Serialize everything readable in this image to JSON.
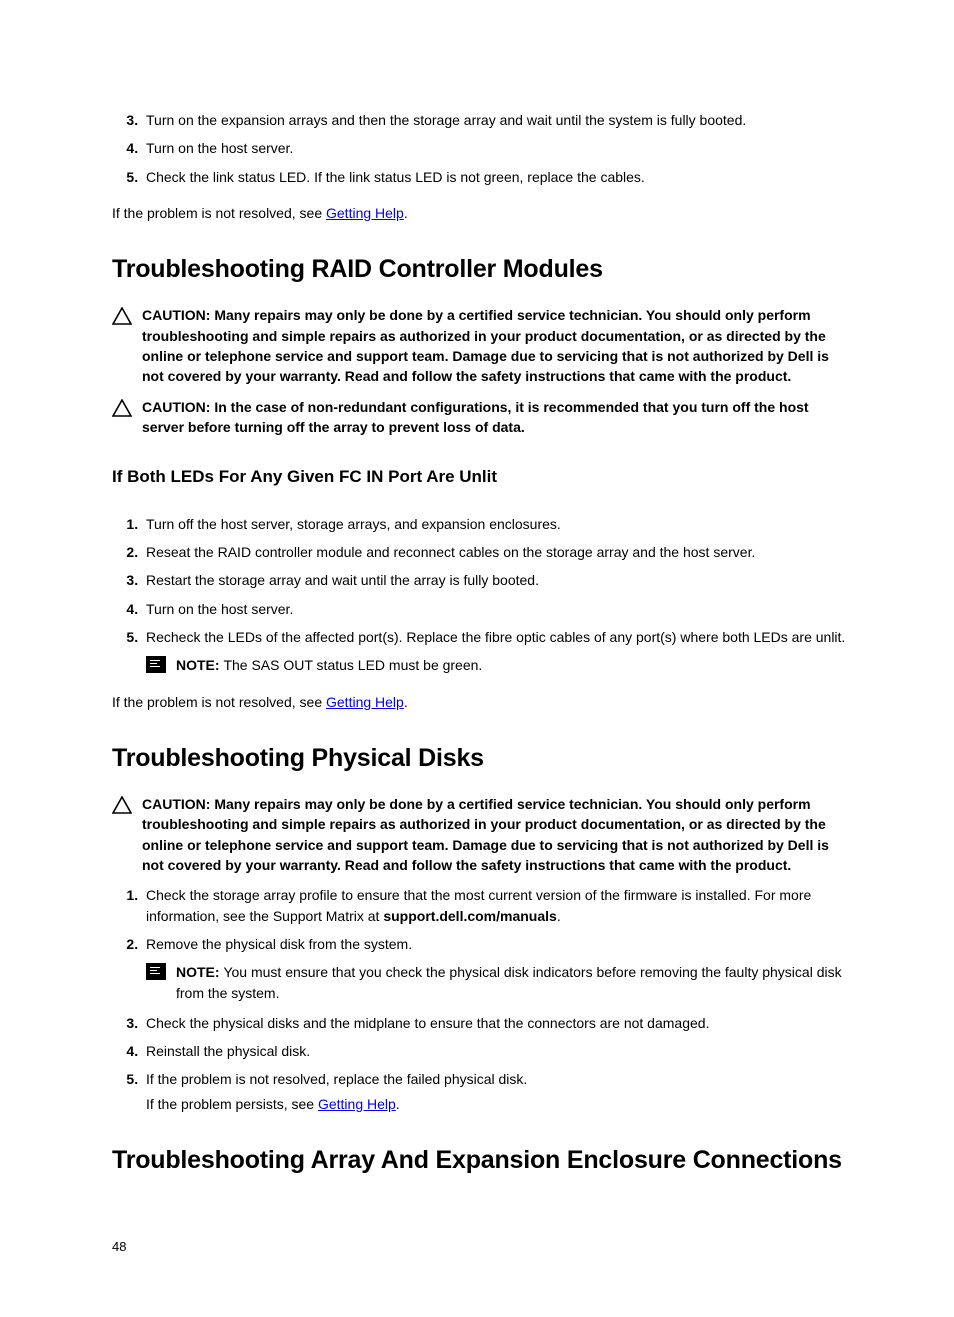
{
  "listA": {
    "i3": "Turn on the expansion arrays and then the storage array and wait until the system is fully booted.",
    "i4": "Turn on the host server.",
    "i5": "Check the link status LED. If the link status LED is not green, replace the cables."
  },
  "paraA_pre": "If the problem is not resolved, see ",
  "paraA_link": "Getting Help",
  "paraA_post": ".",
  "h_raid": "Troubleshooting RAID Controller Modules",
  "caution1_label": "CAUTION: ",
  "caution1_body": "Many repairs may only be done by a certified service technician. You should only perform troubleshooting and simple repairs as authorized in your product documentation, or as directed by the online or telephone service and support team. Damage due to servicing that is not authorized by Dell is not covered by your warranty. Read and follow the safety instructions that came with the product.",
  "caution2_label": "CAUTION: ",
  "caution2_body": "In the case of non-redundant configurations, it is recommended that you turn off the host server before turning off the array to prevent loss of data.",
  "h_leds": "If Both LEDs For Any Given FC IN Port Are Unlit",
  "listB": {
    "i1": "Turn off the host server, storage arrays, and expansion enclosures.",
    "i2": "Reseat the RAID controller module and reconnect cables on the storage array and the host server.",
    "i3": "Restart the storage array and wait until the array is fully booted.",
    "i4": "Turn on the host server.",
    "i5": "Recheck the LEDs of the affected port(s). Replace the fibre optic cables of any port(s) where both LEDs are unlit."
  },
  "note1_label": "NOTE: ",
  "note1_body": "The SAS OUT status LED must be green.",
  "paraB_pre": "If the problem is not resolved, see ",
  "paraB_link": "Getting Help",
  "paraB_post": ".",
  "h_disks": "Troubleshooting Physical Disks",
  "caution3_label": "CAUTION: ",
  "caution3_body": "Many repairs may only be done by a certified service technician. You should only perform troubleshooting and simple repairs as authorized in your product documentation, or as directed by the online or telephone service and support team. Damage due to servicing that is not authorized by Dell is not covered by your warranty. Read and follow the safety instructions that came with the product.",
  "listC": {
    "i1_pre": "Check the storage array profile to ensure that the most current version of the firmware is installed. For more information, see the Support Matrix at ",
    "i1_bold": "support.dell.com/manuals",
    "i1_post": ".",
    "i2": "Remove the physical disk from the system.",
    "note2_label": "NOTE: ",
    "note2_body": "You must ensure that you check the physical disk indicators before removing the faulty physical disk from the system.",
    "i3": "Check the physical disks and the midplane to ensure that the connectors are not damaged.",
    "i4": "Reinstall the physical disk.",
    "i5_line1": "If the problem is not resolved, replace the failed physical disk.",
    "i5_line2_pre": "If the problem persists, see ",
    "i5_line2_link": "Getting Help",
    "i5_line2_post": "."
  },
  "h_array": "Troubleshooting Array And Expansion Enclosure Connections",
  "page_num": "48"
}
